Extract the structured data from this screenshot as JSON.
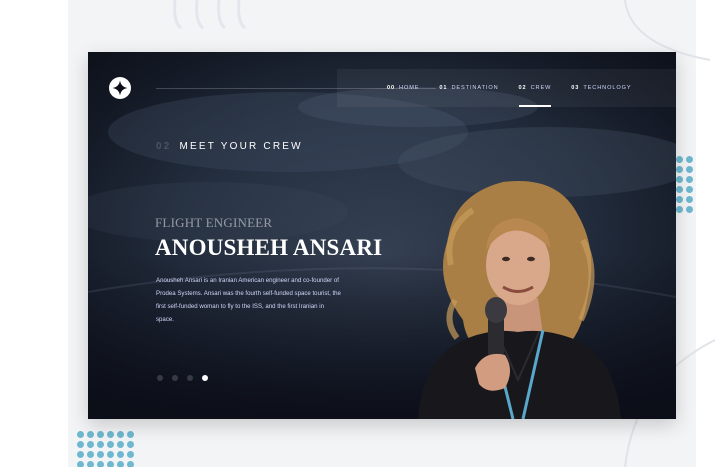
{
  "nav": {
    "items": [
      {
        "number": "00",
        "label": "HOME",
        "active": false
      },
      {
        "number": "01",
        "label": "DESTINATION",
        "active": false
      },
      {
        "number": "02",
        "label": "CREW",
        "active": true
      },
      {
        "number": "03",
        "label": "TECHNOLOGY",
        "active": false
      }
    ]
  },
  "heading": {
    "number": "02",
    "title": "MEET YOUR CREW"
  },
  "crew": {
    "role": "FLIGHT ENGINEER",
    "name": "ANOUSHEH ANSARI",
    "bio": "Anousheh Ansari is an Iranian American engineer and co-founder of Prodea Systems. Ansari was the fourth self-funded space tourist, the first self-funded woman to fly to the ISS, and the first Iranian in space."
  },
  "pager": {
    "count": 4,
    "active_index": 3
  },
  "icons": {
    "logo": "star-logo-icon"
  },
  "colors": {
    "background": "#0b0d17",
    "accent_text": "#d0d6f9",
    "dot_pattern": "#6fb8cf"
  }
}
